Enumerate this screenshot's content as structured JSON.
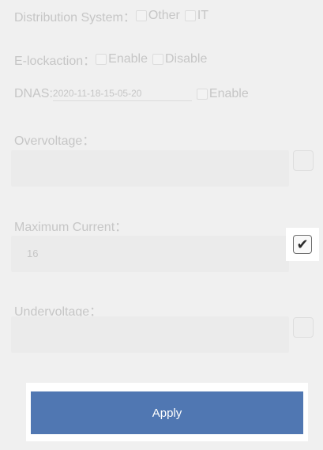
{
  "distribution": {
    "label": "Distribution System：",
    "options": [
      "Other",
      "IT"
    ]
  },
  "elock": {
    "label": "E-lockaction：",
    "options": [
      "Enable",
      "Disable"
    ]
  },
  "dnas": {
    "label": "DNAS:",
    "value": "2020-11-18-15-05-20",
    "option": "Enable"
  },
  "overvoltage": {
    "label": "Overvoltage：",
    "value": "",
    "checked": false
  },
  "maximum_current": {
    "label": "Maximum Current：",
    "value": "16",
    "checked": true
  },
  "undervoltage": {
    "label": "Undervoltage：",
    "value": "",
    "checked": false
  },
  "apply_label": "Apply",
  "colors": {
    "background": "#f0f0f0",
    "faded_text": "#c6c6c6",
    "apply_button": "#5077b2"
  },
  "icons": {
    "checkmark": "check-icon"
  }
}
